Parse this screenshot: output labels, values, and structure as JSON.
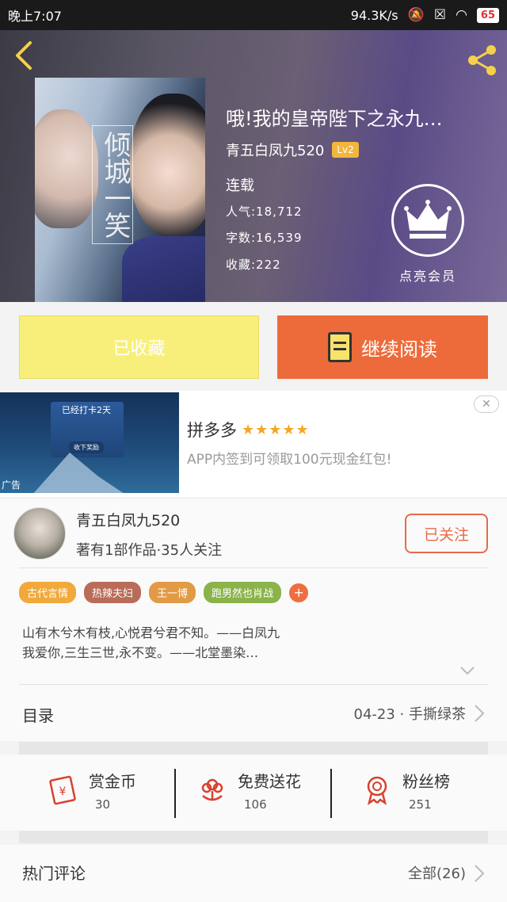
{
  "status_bar": {
    "time": "晚上7:07",
    "network_speed": "94.3K/s",
    "battery": "65"
  },
  "book": {
    "title": "哦!我的皇帝陛下之永九…",
    "author": "青五白凤九520",
    "level": "Lv2",
    "status": "连载",
    "popularity": "人气:18,712",
    "word_count": "字数:16,539",
    "favorites": "收藏:222",
    "cover_text": "倾城一笑",
    "vip_label": "点亮会员"
  },
  "actions": {
    "collected_label": "已收藏",
    "read_label": "继续阅读"
  },
  "ad": {
    "app_name": "拼多多",
    "stars": "★★★★★",
    "description": "APP内签到可领取100元现金红包!",
    "tag": "广告",
    "image_title": "已经打卡2天",
    "image_button": "收下奖励",
    "close": "✕"
  },
  "author_card": {
    "name": "青五白凤九520",
    "meta": "著有1部作品·35人关注",
    "follow_label": "已关注",
    "tags": [
      {
        "label": "古代言情",
        "color": "#f0a93a"
      },
      {
        "label": "热辣夫妇",
        "color": "#b96c58"
      },
      {
        "label": "王一博",
        "color": "#e29a45"
      },
      {
        "label": "跑男然也肖战",
        "color": "#8ab34a"
      }
    ],
    "add_tag": "+",
    "intro_line1": "山有木兮木有枝,心悦君兮君不知。——白凤九",
    "intro_line2": "我爱你,三生三世,永不变。——北堂墨染…"
  },
  "toc": {
    "label": "目录",
    "latest": "04-23 · 手撕绿茶"
  },
  "rewards": [
    {
      "label": "赏金币",
      "count": "30",
      "icon": "red-envelope-icon"
    },
    {
      "label": "免费送花",
      "count": "106",
      "icon": "flower-icon"
    },
    {
      "label": "粉丝榜",
      "count": "251",
      "icon": "medal-icon"
    }
  ],
  "comments": {
    "label": "热门评论",
    "all": "全部(26)"
  },
  "colors": {
    "accent_orange": "#ed6b3a",
    "collected_yellow": "#f8ef7a",
    "reward_red": "#d9412e"
  }
}
